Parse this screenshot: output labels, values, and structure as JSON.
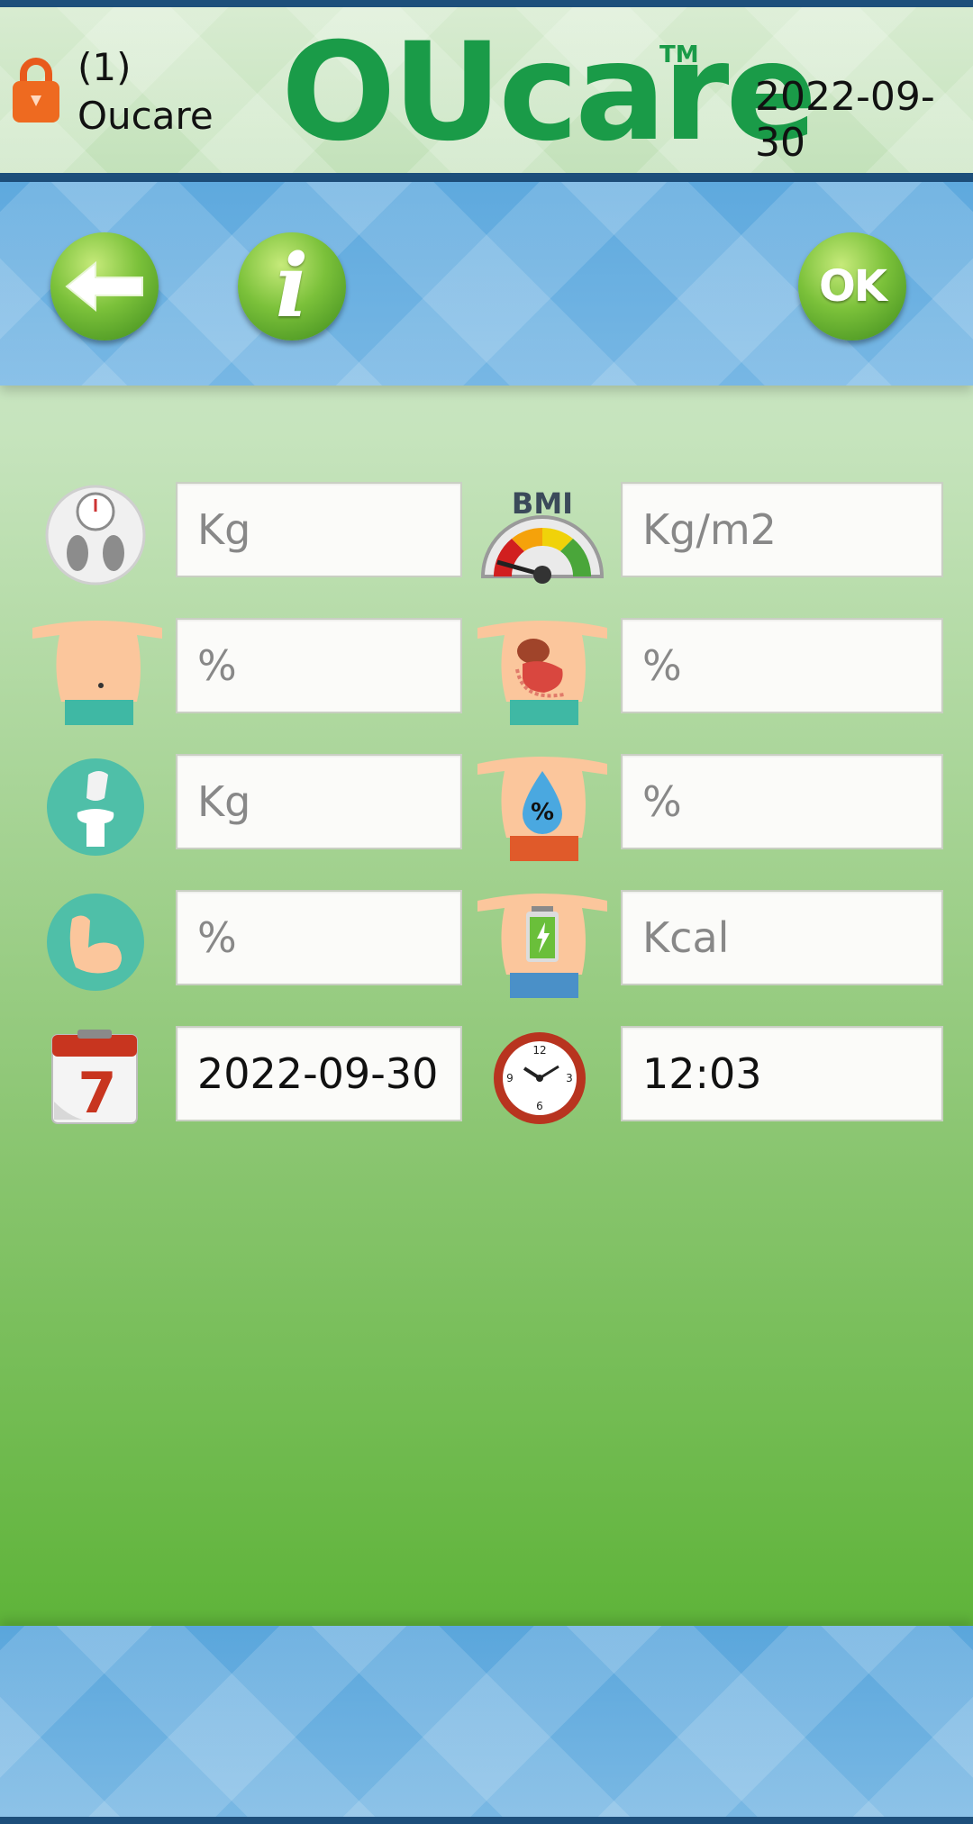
{
  "header": {
    "user_id": "(1)",
    "user_name": "Oucare",
    "logo_text": "OUcare",
    "trademark": "TM",
    "date": "2022-09-30"
  },
  "toolbar": {
    "back_icon": "arrow-left-icon",
    "info_label": "i",
    "ok_label": "OK"
  },
  "fields": {
    "weight": {
      "placeholder": "Kg",
      "value": "",
      "icon": "weight-scale-icon"
    },
    "bmi": {
      "placeholder": "Kg/m2",
      "value": "",
      "icon": "bmi-gauge-icon",
      "icon_label": "BMI"
    },
    "body_fat": {
      "placeholder": "%",
      "value": "",
      "icon": "body-fat-icon"
    },
    "visceral_fat": {
      "placeholder": "%",
      "value": "",
      "icon": "visceral-fat-icon"
    },
    "bone_mass": {
      "placeholder": "Kg",
      "value": "",
      "icon": "bone-icon"
    },
    "body_water": {
      "placeholder": "%",
      "value": "",
      "icon": "body-water-icon",
      "icon_label": "%"
    },
    "muscle": {
      "placeholder": "%",
      "value": "",
      "icon": "muscle-icon"
    },
    "calories": {
      "placeholder": "Kcal",
      "value": "",
      "icon": "energy-battery-icon"
    },
    "date": {
      "value": "2022-09-30",
      "icon": "calendar-icon",
      "icon_label": "7"
    },
    "time": {
      "value": "12:03",
      "icon": "clock-icon"
    }
  },
  "colors": {
    "brand_green": "#1a9b48",
    "header_navy": "#1d4f7b",
    "toolbar_blue": "#5ea9de",
    "button_green": "#7bc13a"
  }
}
